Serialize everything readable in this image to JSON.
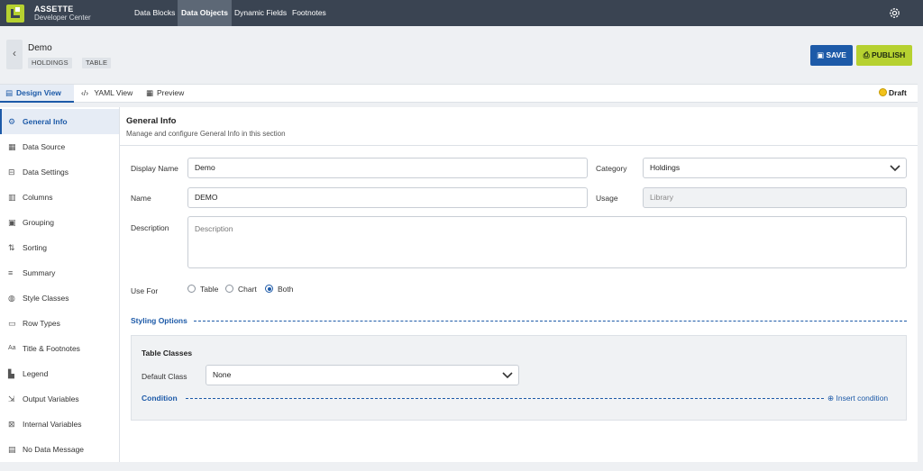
{
  "app": {
    "name": "ASSETTE",
    "subtitle": "Developer Center"
  },
  "nav": [
    "Data Blocks",
    "Data Objects",
    "Dynamic Fields",
    "Footnotes"
  ],
  "object": {
    "name": "Demo",
    "tags": [
      "HOLDINGS",
      "TABLE"
    ]
  },
  "actions": {
    "save": "SAVE",
    "publish": "PUBLISH"
  },
  "tabs": [
    "Design View",
    "YAML View",
    "Preview"
  ],
  "status": "Draft",
  "sidebar": [
    "General Info",
    "Data Source",
    "Data Settings",
    "Columns",
    "Grouping",
    "Sorting",
    "Summary",
    "Style Classes",
    "Row Types",
    "Title & Footnotes",
    "Legend",
    "Output Variables",
    "Internal Variables",
    "No Data Message"
  ],
  "general": {
    "title": "General Info",
    "subtitle": "Manage and configure General Info in this section",
    "display_name_label": "Display Name",
    "display_name_value": "Demo",
    "name_label": "Name",
    "name_value": "DEMO",
    "category_label": "Category",
    "category_value": "Holdings",
    "usage_label": "Usage",
    "usage_value": "Library",
    "description_label": "Description",
    "description_placeholder": "Description",
    "use_for_label": "Use For",
    "use_for_options": [
      "Table",
      "Chart",
      "Both"
    ],
    "use_for_selected": "Both"
  },
  "styling": {
    "title": "Styling Options",
    "table_classes_title": "Table Classes",
    "default_class_label": "Default Class",
    "default_class_value": "None",
    "condition_label": "Condition",
    "insert_condition": "Insert condition"
  },
  "colors": {
    "topbar": "#3a4452",
    "accent": "#1d5aa8",
    "lime": "#b6d130"
  }
}
